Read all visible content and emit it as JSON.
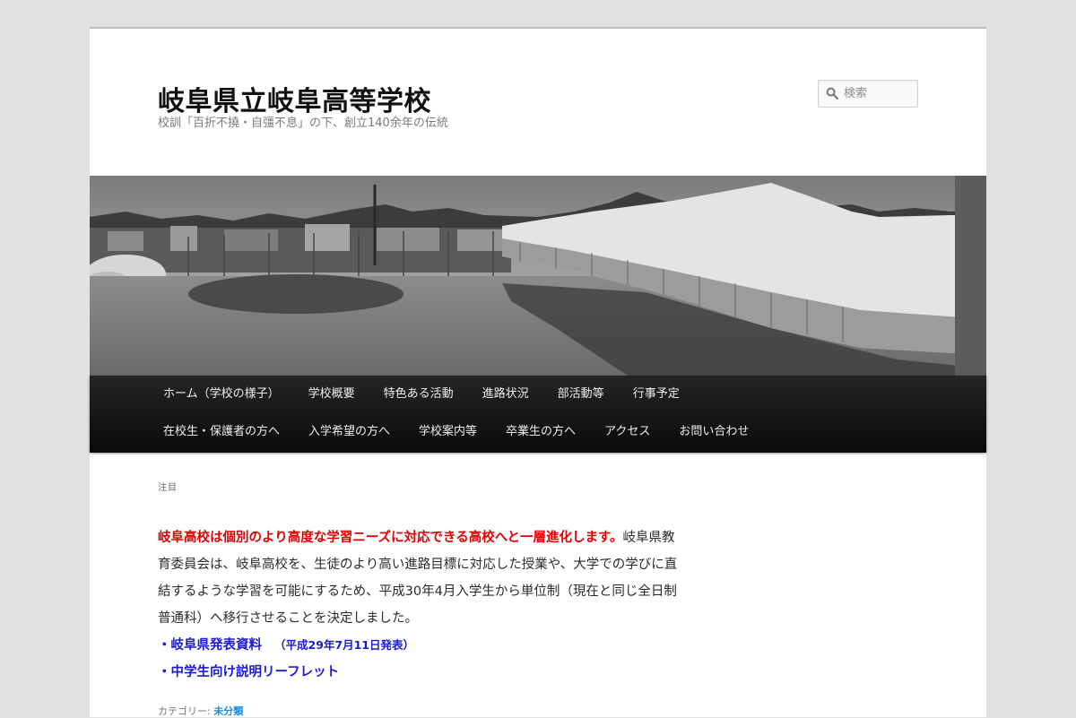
{
  "site": {
    "title": "岐阜県立岐阜高等学校",
    "description": "校訓「百折不撓・自彊不息」の下、創立140余年の伝統"
  },
  "search": {
    "placeholder": "検索",
    "icon": "search-icon"
  },
  "nav": {
    "items": [
      "ホーム（学校の様子）",
      "学校概要",
      "特色ある活動",
      "進路状況",
      "部活動等",
      "行事予定",
      "在校生・保護者の方へ",
      "入学希望の方へ",
      "学校案内等",
      "卒業生の方へ",
      "アクセス",
      "お問い合わせ"
    ]
  },
  "post": {
    "featured_label": "注目",
    "lead_red": "岐阜高校は個別のより高度な学習ニーズに対応できる高校へと一層進化します。",
    "body": "岐阜県教育委員会は、岐阜高校を、生徒のより高い進路目標に対応した授業や、大学での学びに直結するような学習を可能にするため、平成30年4月入学生から単位制（現在と同じ全日制普通科）へ移行させることを決定しました。",
    "link1_label": "・岐阜県発表資料",
    "link1_date": "（平成29年7月11日発表）",
    "link2_label": "・中学生向け説明リーフレット",
    "category_prefix": "カテゴリー:",
    "category": "未分類"
  },
  "colors": {
    "accent_red": "#e00000",
    "link_blue": "#1a1ad2",
    "category_blue": "#1b8be0",
    "nav_bg": "#151515"
  }
}
